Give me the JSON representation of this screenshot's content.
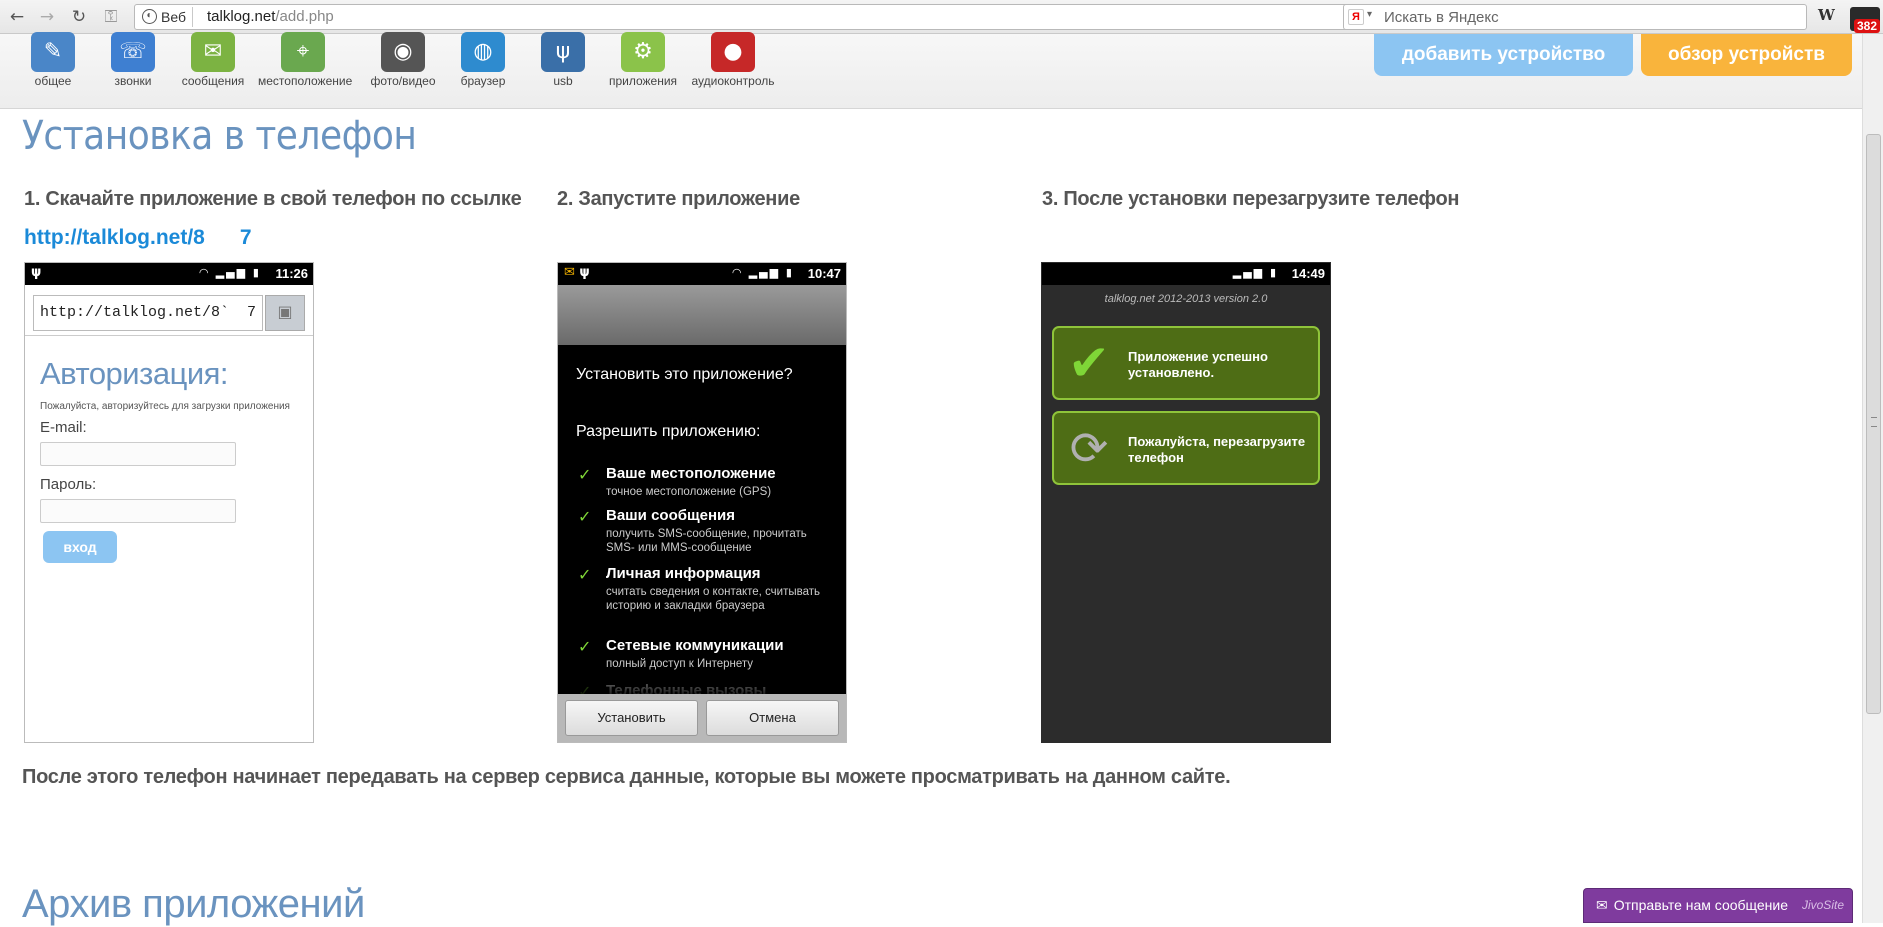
{
  "browser": {
    "chip_label": "Веб",
    "url_host": "talklog.net",
    "url_path": "/add.php",
    "search_placeholder": "Искать в Яндекс",
    "badge_count": "382"
  },
  "toolbar": {
    "items": [
      {
        "label": "общее",
        "icon": "general-icon",
        "color": "#4a86c8"
      },
      {
        "label": "звонки",
        "icon": "phone-icon",
        "color": "#3e7fd1"
      },
      {
        "label": "сообщения",
        "icon": "message-icon",
        "color": "#7cb342"
      },
      {
        "label": "местоположение",
        "icon": "map-icon",
        "color": "#6aa84f"
      },
      {
        "label": "фото/видео",
        "icon": "camera-icon",
        "color": "#555555"
      },
      {
        "label": "браузер",
        "icon": "globe-icon",
        "color": "#2e8bcf"
      },
      {
        "label": "usb",
        "icon": "usb-icon",
        "color": "#3a6fa8"
      },
      {
        "label": "приложения",
        "icon": "android-icon",
        "color": "#8bc34a"
      },
      {
        "label": "аудиоконтроль",
        "icon": "microphone-icon",
        "color": "#c62828"
      }
    ],
    "add_device": "добавить устройство",
    "overview_device": "обзор устройств"
  },
  "main": {
    "title": "Установка в телефон",
    "step1": "1. Скачайте приложение в свой телефон по ссылке",
    "step1_link": "http://talklog.net/8      7",
    "step2": "2. Запустите приложение",
    "step3": "3. После установки перезагрузите телефон",
    "footer": "После этого телефон начинает передавать на сервер сервиса данные, которые вы можете просматривать на данном сайте.",
    "archive_title": "Архив приложений"
  },
  "phone1": {
    "time": "11:26",
    "url": "http://talklog.net/8`  7",
    "heading": "Авторизация:",
    "subtitle": "Пожалуйста, авторизуйтесь для загрузки приложения",
    "email_label": "E-mail:",
    "password_label": "Пароль:",
    "login_button": "вход"
  },
  "phone2": {
    "time": "10:47",
    "question": "Установить это приложение?",
    "permissions_header": "Разрешить приложению:",
    "permissions": [
      {
        "title": "Ваше местоположение",
        "desc": "точное местоположение (GPS)"
      },
      {
        "title": "Ваши сообщения",
        "desc": "получить SMS-сообщение, прочитать SMS- или MMS-сообщение"
      },
      {
        "title": "Личная информация",
        "desc": "считать сведения о контакте, считывать историю и закладки браузера"
      },
      {
        "title": "Сетевые коммуникации",
        "desc": "полный доступ к Интернету"
      },
      {
        "title": "Телефонные вызовы",
        "desc": ""
      }
    ],
    "install_button": "Установить",
    "cancel_button": "Отмена"
  },
  "phone3": {
    "time": "14:49",
    "version": "talklog.net 2012-2013 version 2.0",
    "success": "Приложение успешно установлено.",
    "reboot": "Пожалуйста, перезагрузите телефон"
  },
  "jivo": {
    "label": "Отправьте нам сообщение",
    "brand": "JivoSite"
  }
}
